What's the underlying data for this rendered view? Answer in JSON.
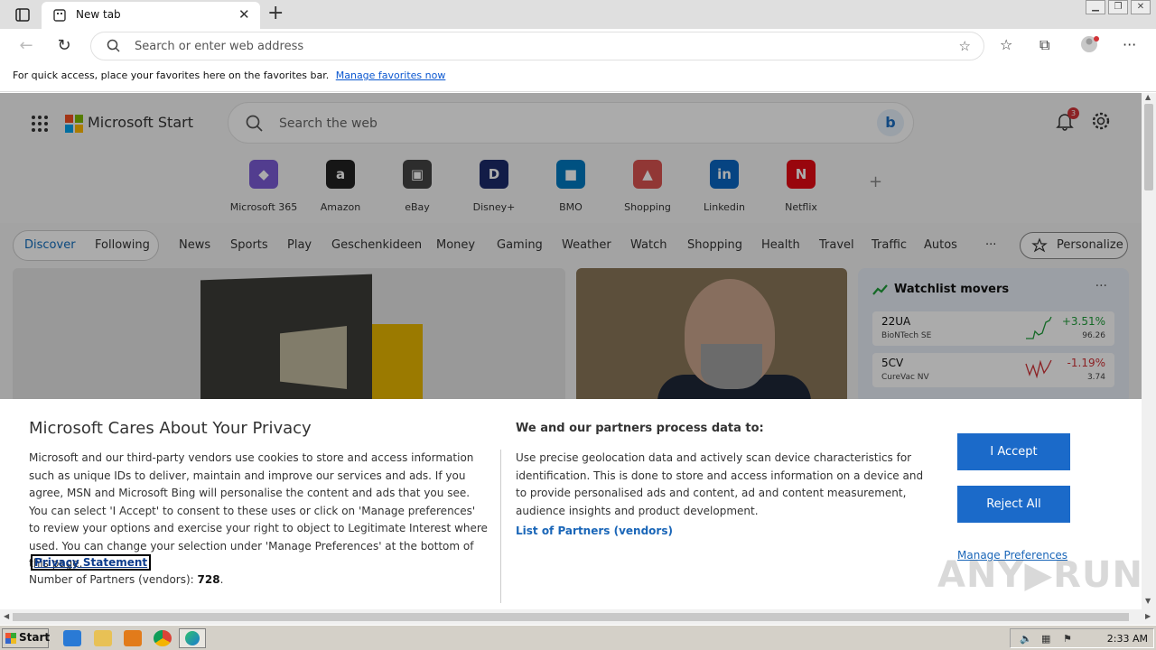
{
  "browser": {
    "tab_title": "New tab",
    "tab_close": "✕",
    "new_tab": "+",
    "address_placeholder": "Search or enter web address",
    "favorites_bar_text": "For quick access, place your favorites here on the favorites bar.",
    "favorites_bar_link": "Manage favorites now"
  },
  "start_page": {
    "brand": "Microsoft Start",
    "search_placeholder": "Search the web",
    "notification_count": "3",
    "quick_links": [
      {
        "label": "Microsoft 365",
        "glyph": "◆",
        "color": "#7b5cd6"
      },
      {
        "label": "Amazon",
        "glyph": "a",
        "color": "#222222"
      },
      {
        "label": "eBay",
        "glyph": "▣",
        "color": "#444444"
      },
      {
        "label": "Disney+",
        "glyph": "D",
        "color": "#1b2a6b"
      },
      {
        "label": "BMO",
        "glyph": "■",
        "color": "#0079c1"
      },
      {
        "label": "Shopping",
        "glyph": "▲",
        "color": "#d9534f"
      },
      {
        "label": "Linkedin",
        "glyph": "in",
        "color": "#0a66c2"
      },
      {
        "label": "Netflix",
        "glyph": "N",
        "color": "#e50914"
      }
    ],
    "add_site": "+",
    "feed_tabs": {
      "discover": "Discover",
      "following": "Following"
    },
    "categories": [
      "News",
      "Sports",
      "Play",
      "Geschenkideen",
      "Money",
      "Gaming",
      "Weather",
      "Watch",
      "Shopping",
      "Health",
      "Travel",
      "Traffic",
      "Autos",
      "···"
    ],
    "personalize": "Personalize",
    "watchlist": {
      "title": "Watchlist movers",
      "more": "···",
      "stocks": [
        {
          "symbol": "22UA",
          "name": "BioNTech SE",
          "change": "+3.51%",
          "price": "96.26",
          "trend": "up"
        },
        {
          "symbol": "5CV",
          "name": "CureVac NV",
          "change": "-1.19%",
          "price": "3.74",
          "trend": "down"
        }
      ]
    }
  },
  "privacy": {
    "title": "Microsoft Cares About Your Privacy",
    "body": "Microsoft and our third-party vendors use cookies to store and access information such as unique IDs to deliver, maintain and improve our services and ads. If you agree, MSN and Microsoft Bing will personalise the content and ads that you see. You can select 'I Accept' to consent to these uses or click on 'Manage preferences' to review your options and exercise your right to object to Legitimate Interest where used.  You can change your selection under 'Manage Preferences' at the bottom of this page.",
    "privacy_link": "Privacy Statement",
    "partners_label": "Number of Partners (vendors):",
    "partners_count": "728",
    "partners_period": ".",
    "process_heading": "We and our partners process data to:",
    "process_body": "Use precise geolocation data and actively scan device characteristics for identification. This is done to store and access information on a device and to provide personalised ads and content, ad and content measurement, audience insights and product development.",
    "partners_list_link": "List of Partners (vendors)",
    "accept": "I Accept",
    "reject": "Reject All",
    "manage": "Manage Preferences"
  },
  "watermark": "ANY▶RUN",
  "taskbar": {
    "start": "Start",
    "clock": "2:33 AM"
  }
}
